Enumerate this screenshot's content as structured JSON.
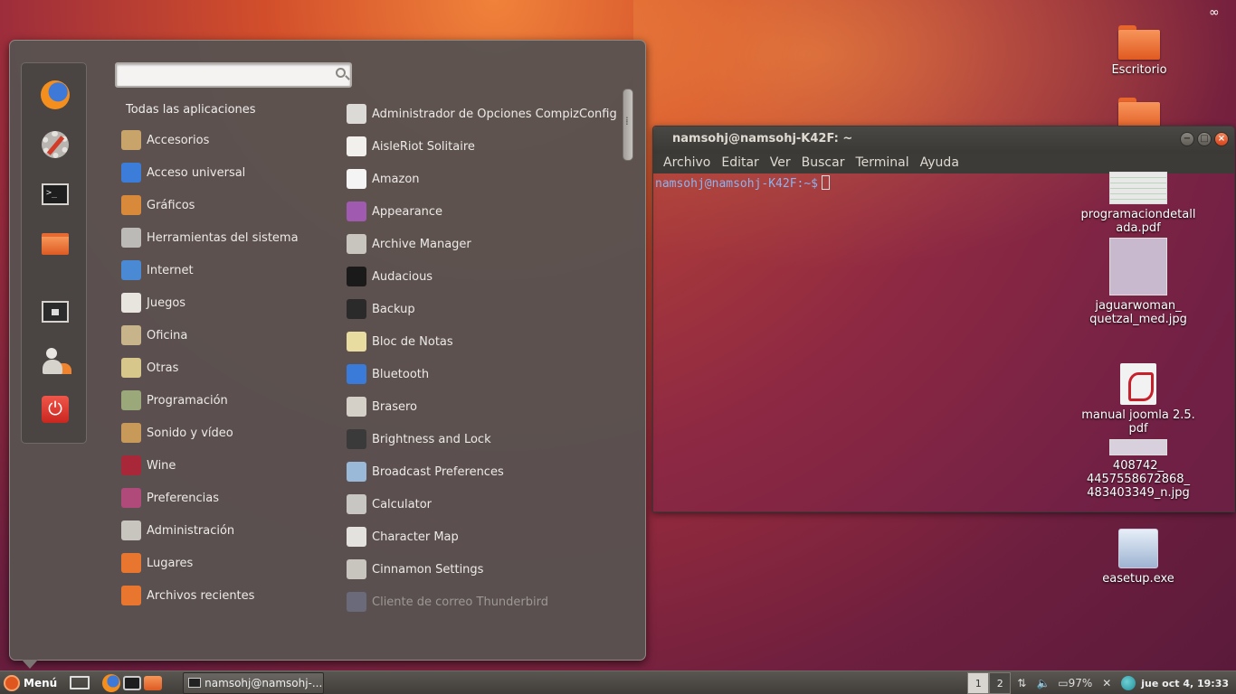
{
  "desktop": {
    "icons": [
      {
        "label": "Escritorio"
      },
      {
        "label": ""
      },
      {
        "label": "programaciondetallada.pdf",
        "label_lines": [
          "programaciondetall",
          "ada.pdf"
        ]
      },
      {
        "label": "jaguarwoman_quetzal_med.jpg",
        "label_lines": [
          "jaguarwoman_",
          "quetzal_med.jpg"
        ]
      },
      {
        "label": "manual joomla 2.5.pdf",
        "label_lines": [
          "manual joomla 2.5.",
          "pdf"
        ]
      },
      {
        "label": "408742_4457558672868_483403349_n.jpg",
        "label_lines": [
          "408742_",
          "4457558672868_",
          "483403349_n.jpg"
        ]
      },
      {
        "label": "easetup.exe"
      }
    ]
  },
  "terminal": {
    "title": "namsohj@namsohj-K42F: ~",
    "menu": [
      "Archivo",
      "Editar",
      "Ver",
      "Buscar",
      "Terminal",
      "Ayuda"
    ],
    "prompt": "namsohj@namsohj-K42F:~$"
  },
  "menu": {
    "search": {
      "value": "",
      "placeholder": ""
    },
    "all_apps_label": "Todas las aplicaciones",
    "favorites": [
      {
        "name": "firefox",
        "icon": "firefox-icon"
      },
      {
        "name": "settings",
        "icon": "settings-gear-icon"
      },
      {
        "name": "terminal",
        "icon": "terminal-icon"
      },
      {
        "name": "home-folder",
        "icon": "folder-icon"
      },
      {
        "name": "lock-screen",
        "icon": "lock-screen-icon"
      },
      {
        "name": "logout",
        "icon": "logout-icon"
      },
      {
        "name": "shutdown",
        "icon": "power-icon"
      }
    ],
    "categories": [
      {
        "label": "Accesorios",
        "color": "#c8a46a"
      },
      {
        "label": "Acceso universal",
        "color": "#3b7dd8"
      },
      {
        "label": "Gráficos",
        "color": "#d88a3a"
      },
      {
        "label": "Herramientas del sistema",
        "color": "#bcbab6"
      },
      {
        "label": "Internet",
        "color": "#4a8ad4"
      },
      {
        "label": "Juegos",
        "color": "#e8e4de"
      },
      {
        "label": "Oficina",
        "color": "#c8b48a"
      },
      {
        "label": "Otras",
        "color": "#d8c78a"
      },
      {
        "label": "Programación",
        "color": "#9aa87a"
      },
      {
        "label": "Sonido y vídeo",
        "color": "#c89a5a"
      },
      {
        "label": "Wine",
        "color": "#a8283a"
      },
      {
        "label": "Preferencias",
        "color": "#b04a7a"
      },
      {
        "label": "Administración",
        "color": "#c8c4be"
      },
      {
        "label": "Lugares",
        "color": "#e8762e"
      },
      {
        "label": "Archivos recientes",
        "color": "#e8762e"
      }
    ],
    "apps": [
      {
        "label": "Administrador de Opciones CompizConfig",
        "color": "#dcdad6"
      },
      {
        "label": "AisleRiot Solitaire",
        "color": "#f2f0ec"
      },
      {
        "label": "Amazon",
        "color": "#f4f4f4"
      },
      {
        "label": "Appearance",
        "color": "#a05ab0"
      },
      {
        "label": "Archive Manager",
        "color": "#c8c4be"
      },
      {
        "label": "Audacious",
        "color": "#1a1a1a"
      },
      {
        "label": "Backup",
        "color": "#2a2a2a"
      },
      {
        "label": "Bloc de Notas",
        "color": "#e8dca0"
      },
      {
        "label": "Bluetooth",
        "color": "#3a7ad8"
      },
      {
        "label": "Brasero",
        "color": "#d4d0c8"
      },
      {
        "label": "Brightness and Lock",
        "color": "#3a3a3a"
      },
      {
        "label": "Broadcast Preferences",
        "color": "#9ab8d8"
      },
      {
        "label": "Calculator",
        "color": "#c8c6c2"
      },
      {
        "label": "Character Map",
        "color": "#e4e2de"
      },
      {
        "label": "Cinnamon Settings",
        "color": "#c8c4be"
      },
      {
        "label": "Cliente de correo Thunderbird",
        "color": "#6a6a7a"
      }
    ]
  },
  "taskbar": {
    "menu_label": "Menú",
    "task_label": "namsohj@namsohj-...",
    "workspaces": [
      "1",
      "2"
    ],
    "battery": "97%",
    "clock": "jue oct  4, 19:33"
  }
}
